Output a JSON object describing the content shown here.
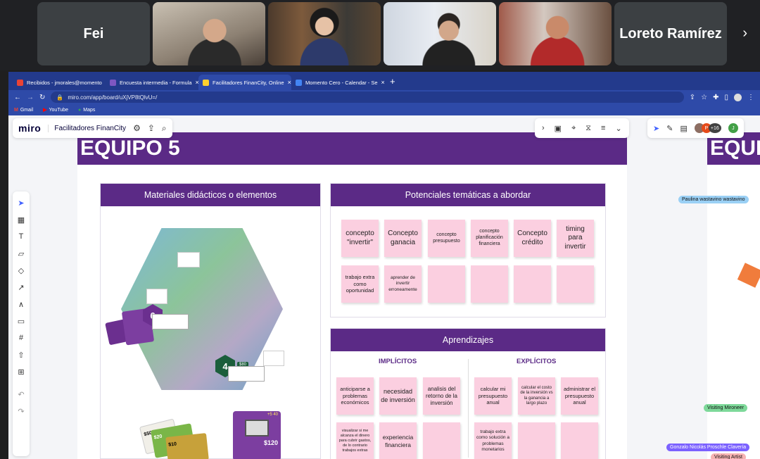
{
  "meeting": {
    "participants": [
      {
        "name": "Fei",
        "type": "name"
      },
      {
        "name": "",
        "type": "video"
      },
      {
        "name": "",
        "type": "video"
      },
      {
        "name": "",
        "type": "video"
      },
      {
        "name": "",
        "type": "video"
      },
      {
        "name": "Loreto Ramírez",
        "type": "name"
      }
    ],
    "next_icon": "chevron-right-icon"
  },
  "browser": {
    "tabs": [
      {
        "label": "Recibidos - jmorales@momento",
        "color": "#ea4335"
      },
      {
        "label": "Encuesta intermedia - Formula",
        "color": "#7e57c2"
      },
      {
        "label": "Facilitadores FinanCity, Online",
        "color": "#ffd02f",
        "active": true
      },
      {
        "label": "Momento Cero - Calendar - Se",
        "color": "#4285f4"
      }
    ],
    "url": "miro.com/app/board/uXjVP8tQlvU=/",
    "bookmarks": [
      "Gmail",
      "YouTube",
      "Maps"
    ]
  },
  "miro": {
    "logo": "miro",
    "board_name": "Facilitadores FinanCity",
    "collab_count": "+16",
    "user_initial": "J",
    "avatar_initial": "P"
  },
  "board": {
    "title": "EQUIPO 5",
    "title2": "EQUI",
    "materials": {
      "header": "Materiales didácticos o elementos",
      "badge1": "6",
      "badge2": "4",
      "price_tag": "$80",
      "card_price": "$120",
      "card_top": "+5  40",
      "money1": "$50",
      "money2": "$20",
      "money3": "$10"
    },
    "themes": {
      "header": "Potenciales temáticas a abordar",
      "notes": [
        "concepto \"invertir\"",
        "Concepto ganacia",
        "concepto presupuesto",
        "concepto planificación financiera",
        "Concepto crédito",
        "timing para invertir",
        "trabajo extra como oportunidad",
        "aprender de invertir erroneamente",
        "",
        "",
        "",
        ""
      ]
    },
    "learnings": {
      "header": "Aprendizajes",
      "implicit_title": "IMPLÍCITOS",
      "explicit_title": "EXPLÍCITOS",
      "implicit_notes": [
        "anticiparse a problemas económicos",
        "necesidad de inversión",
        "analisis del retorno de la inversión",
        "visualizar si me alcanza el dinero para cubrir gastos, de lo contrario trabajos extras",
        "experiencia financiera",
        ""
      ],
      "explicit_notes": [
        "calcular mi presupuesto anual",
        "calcular el costo de la inversión vs la ganancia a largo plazo",
        "administrar el presupuesto anual",
        "trabajo extra como solución a problemas monetarios",
        "",
        ""
      ]
    }
  },
  "cursors": [
    {
      "label": "Paulina wastavino wastavino",
      "color": "#9ad0f5"
    },
    {
      "label": "Visiting Mironeer",
      "color": "#7ed99a"
    },
    {
      "label": "Gonzalo Nicolás Proschle Clavería",
      "color": "#7b61ff"
    },
    {
      "label": "Visiting Artist",
      "color": "#f7b3b3"
    }
  ]
}
